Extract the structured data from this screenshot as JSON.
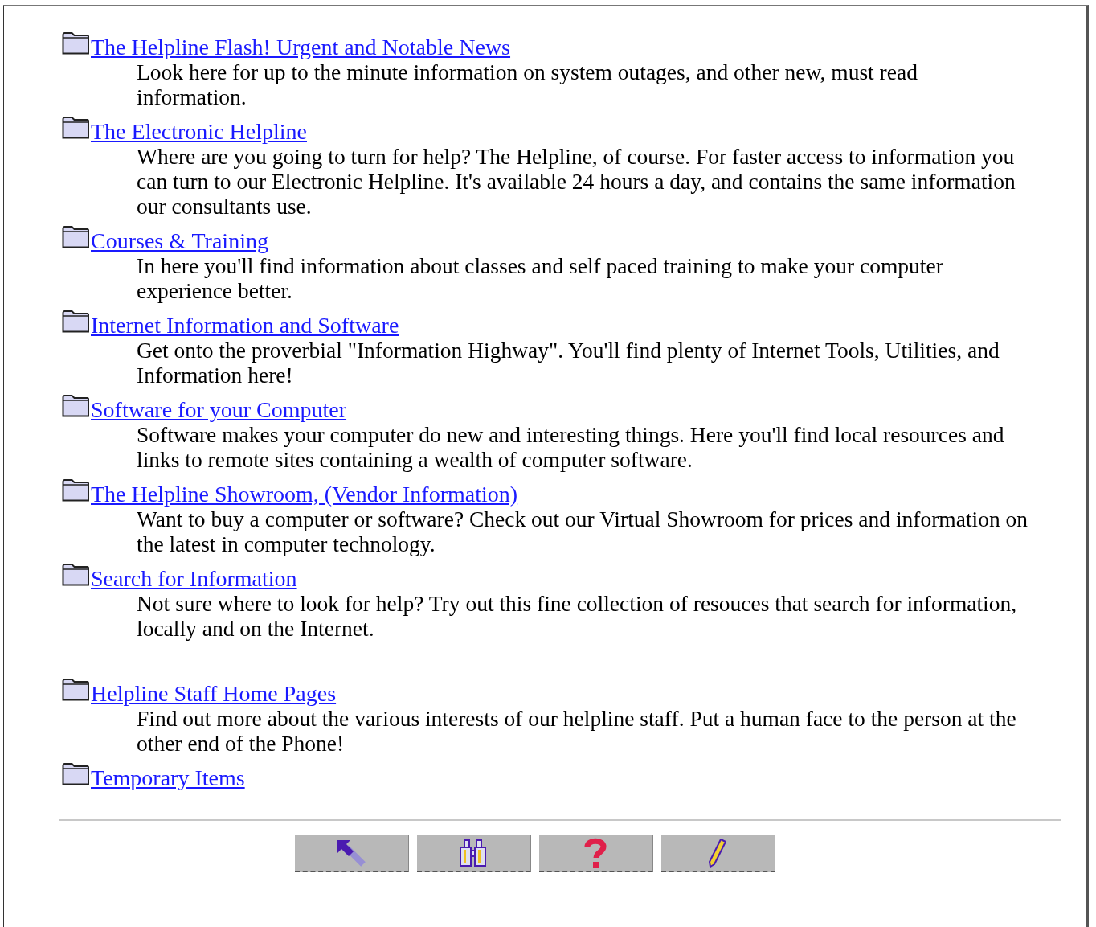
{
  "items": [
    {
      "title": "The Helpline Flash! Urgent and Notable News",
      "description": "Look here for up to the minute information on system outages, and other new, must read information.",
      "space_before": false
    },
    {
      "title": "The Electronic Helpline",
      "description": "Where are you going to turn for help? The Helpline, of course. For faster access to information you can turn to our Electronic Helpline. It's available 24 hours a day, and contains the same information our consultants use.",
      "space_before": false
    },
    {
      "title": "Courses & Training",
      "description": "In here you'll find information about classes and self paced training to make your computer experience better.",
      "space_before": false
    },
    {
      "title": "Internet Information and Software",
      "description": "Get onto the proverbial \"Information Highway\". You'll find plenty of Internet Tools, Utilities, and Information here!",
      "space_before": false
    },
    {
      "title": "Software for your Computer",
      "description": "Software makes your computer do new and interesting things. Here you'll find local resources and links to remote sites containing a wealth of computer software.",
      "space_before": false
    },
    {
      "title": "The Helpline Showroom, (Vendor Information)",
      "description": "Want to buy a computer or software? Check out our Virtual Showroom for prices and information on the latest in computer technology.",
      "space_before": false
    },
    {
      "title": "Search for Information",
      "description": "Not sure where to look for help? Try out this fine collection of resouces that search for information, locally and on the Internet.",
      "space_before": false
    },
    {
      "title": "Helpline Staff Home Pages",
      "description": "Find out more about the various interests of our helpline staff. Put a human face to the person at the other end of the Phone!",
      "space_before": true
    },
    {
      "title": "Temporary Items",
      "space_before": false
    }
  ],
  "toolbar": [
    {
      "kind": "back"
    },
    {
      "kind": "search"
    },
    {
      "kind": "help"
    },
    {
      "kind": "edit"
    }
  ]
}
